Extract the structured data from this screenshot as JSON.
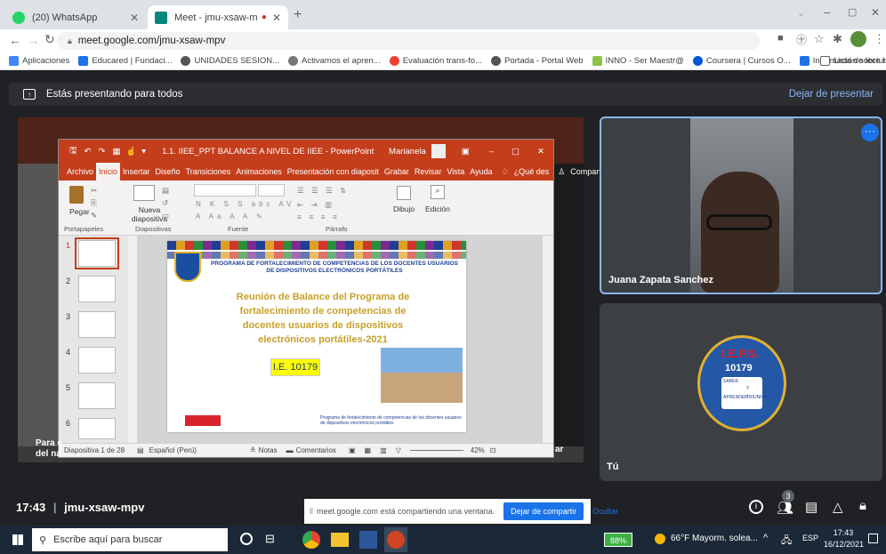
{
  "browser": {
    "tabs": [
      {
        "title": "(20) WhatsApp",
        "active": false
      },
      {
        "title": "Meet - jmu-xsaw-mpv",
        "active": true
      }
    ],
    "url": "meet.google.com/jmu-xsaw-mpv",
    "bookmarks": [
      "Aplicaciones",
      "Educared | Fundaci...",
      "UNIDADES SESION...",
      "Activamos el apren...",
      "Evaluación trans-fo...",
      "Portada - Portal Web",
      "INNO - Ser Maestr@",
      "Coursera | Cursos O...",
      "Información sobre l..."
    ],
    "reading_list": "Lista de lectura"
  },
  "meet": {
    "presenting_text": "Estás presentando para todos",
    "stop_presenting": "Dejar de presentar",
    "time": "17:43",
    "meeting_code": "jmu-xsaw-mpv",
    "participant1": "Juana Zapata Sanchez",
    "participant2": "Tú",
    "participants_count": "3",
    "share_notice": "meet.google.com está compartiendo una ventana.",
    "stop_sharing": "Dejar de compartir",
    "hide": "Ocultar",
    "caption_left_1": "Para e",
    "caption_left_2": "del na",
    "caption_right": "ar"
  },
  "ppt": {
    "title": "1.1. IIEE_PPT BALANCE A NIVEL DE IIEE - PowerPoint",
    "user": "Marianela",
    "menu": [
      "Archivo",
      "Inicio",
      "Insertar",
      "Diseño",
      "Transiciones",
      "Animaciones",
      "Presentación con diaposit",
      "Grabar",
      "Revisar",
      "Vista",
      "Ayuda",
      "¿Qué des",
      "Compartir"
    ],
    "ribbon": {
      "paste": "Pegar",
      "new_slide": "Nueva diapositiva",
      "drawing": "Dibujo",
      "edit": "Edición",
      "groups": [
        "Portapapeles",
        "Diapositivas",
        "Fuente",
        "Párrafo"
      ]
    },
    "thumb_numbers": [
      "1",
      "2",
      "3",
      "4",
      "5",
      "6"
    ],
    "status": {
      "slide": "Diapositiva 1 de 28",
      "lang": "Español (Perú)",
      "notes": "Notas",
      "comments": "Comentarios",
      "zoom": "42%"
    },
    "slide": {
      "header": "PROGRAMA DE FORTALECIMIENTO DE COMPETENCIAS DE LOS DOCENTES USUARIOS DE DISPOSITIVOS ELECTRÓNICOS PORTÁTILES",
      "title": "Reunión de Balance del Programa de fortalecimiento de competencias de docentes usuarios de dispositivos electrónicos portátiles-2021",
      "ie": "I.E. 10179",
      "footer": "Programa de fortalecimiento de competencias de los docentes usuarios de dispositivos electrónicos portátiles"
    }
  },
  "badge": {
    "top": "I.E.P.S.",
    "num": "10179",
    "motto1": "SABER",
    "motto2": "Y",
    "motto3": "APRENDER",
    "motto4": "TRIUNFAR"
  },
  "taskbar": {
    "search": "Escribe aquí para buscar",
    "battery": "88%",
    "weather": "66°F Mayorm. solea...",
    "lang": "ESP",
    "time": "17:43",
    "date": "16/12/2021"
  }
}
